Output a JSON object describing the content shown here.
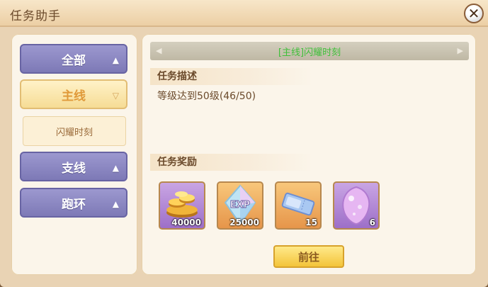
{
  "window": {
    "title": "任务助手"
  },
  "categories": [
    {
      "label": "全部",
      "arrow": "▲"
    },
    {
      "label": "主线",
      "arrow": "▽"
    },
    {
      "label": "支线",
      "arrow": "▲"
    },
    {
      "label": "跑环",
      "arrow": "▲"
    }
  ],
  "sub_items": [
    {
      "label": "闪耀时刻"
    }
  ],
  "quest": {
    "title": "[主线]闪耀时刻",
    "description_heading": "任务描述",
    "description": "等级达到50级(46/50)",
    "reward_heading": "任务奖励",
    "rewards": [
      {
        "icon": "gold-coins-icon",
        "count": "40000"
      },
      {
        "icon": "exp-crystal-icon",
        "count": "25000"
      },
      {
        "icon": "ticket-icon",
        "count": "15"
      },
      {
        "icon": "gem-icon",
        "count": "6"
      }
    ],
    "go_label": "前往"
  },
  "colors": {
    "category_blue": "#8783c0",
    "category_selected": "#f6dc95",
    "quest_title_green": "#3fbf3a",
    "go_button": "#f3c43a"
  }
}
